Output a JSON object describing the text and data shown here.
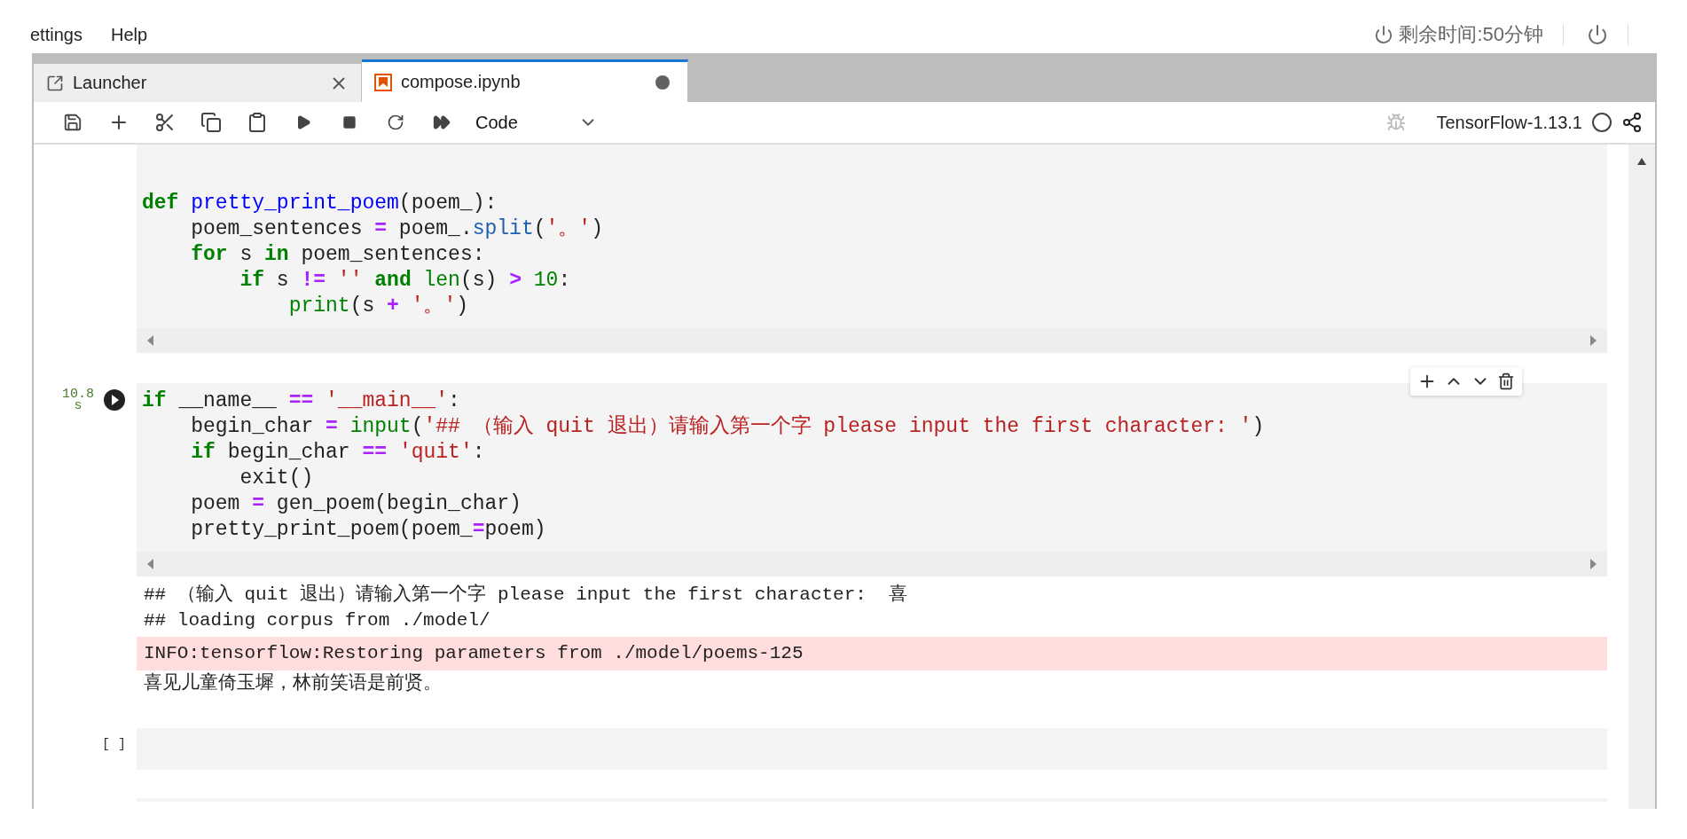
{
  "menu": [
    {
      "label": "ettings"
    },
    {
      "label": "Help"
    }
  ],
  "session": {
    "remaining": "剩余时间:50分钟"
  },
  "tabs": [
    {
      "label": "Launcher",
      "kind": "launcher",
      "selected": false,
      "dirty": false
    },
    {
      "label": "compose.ipynb",
      "kind": "notebook",
      "selected": true,
      "dirty": true
    }
  ],
  "toolbar": {
    "cell_type": "Code",
    "kernel": "TensorFlow-1.13.1"
  },
  "cells": [
    {
      "kind": "code",
      "run_button": false,
      "lines": [
        [
          {
            "kind": "kw",
            "text": "def "
          },
          {
            "kind": "fn",
            "text": "pretty_print_poem"
          },
          {
            "kind": "p",
            "text": "(poem_):"
          }
        ],
        [
          {
            "kind": "p",
            "text": "    poem_sentences "
          },
          {
            "kind": "op",
            "text": "="
          },
          {
            "kind": "p",
            "text": " poem_."
          },
          {
            "kind": "me",
            "text": "split"
          },
          {
            "kind": "p",
            "text": "("
          },
          {
            "kind": "st",
            "text": "'。'"
          },
          {
            "kind": "p",
            "text": ")"
          }
        ],
        [
          {
            "kind": "kw",
            "text": "    for"
          },
          {
            "kind": "p",
            "text": " s "
          },
          {
            "kind": "kw",
            "text": "in"
          },
          {
            "kind": "p",
            "text": " poem_sentences:"
          }
        ],
        [
          {
            "kind": "kw",
            "text": "        if"
          },
          {
            "kind": "p",
            "text": " s "
          },
          {
            "kind": "op",
            "text": "!="
          },
          {
            "kind": "st",
            "text": " ''"
          },
          {
            "kind": "kw",
            "text": " and"
          },
          {
            "kind": "bi",
            "text": " len"
          },
          {
            "kind": "p",
            "text": "(s) "
          },
          {
            "kind": "op",
            "text": ">"
          },
          {
            "kind": "nu",
            "text": " 10"
          },
          {
            "kind": "p",
            "text": ":"
          }
        ],
        [
          {
            "kind": "bi",
            "text": "            print"
          },
          {
            "kind": "p",
            "text": "(s "
          },
          {
            "kind": "op",
            "text": "+"
          },
          {
            "kind": "st",
            "text": " '。'"
          },
          {
            "kind": "p",
            "text": ")"
          }
        ]
      ]
    },
    {
      "kind": "code",
      "prompt": "10.8\ns",
      "run_button": true,
      "lines": [
        [
          {
            "kind": "kw",
            "text": "if"
          },
          {
            "kind": "p",
            "text": " __name__ "
          },
          {
            "kind": "op",
            "text": "=="
          },
          {
            "kind": "st",
            "text": " '__main__'"
          },
          {
            "kind": "p",
            "text": ":"
          }
        ],
        [
          {
            "kind": "p",
            "text": "    begin_char "
          },
          {
            "kind": "op",
            "text": "="
          },
          {
            "kind": "bi",
            "text": " input"
          },
          {
            "kind": "p",
            "text": "("
          },
          {
            "kind": "st",
            "text": "'## （输入 quit 退出）请输入第一个字 please input the first character: '"
          },
          {
            "kind": "p",
            "text": ")"
          }
        ],
        [
          {
            "kind": "kw",
            "text": "    if"
          },
          {
            "kind": "p",
            "text": " begin_char "
          },
          {
            "kind": "op",
            "text": "=="
          },
          {
            "kind": "st",
            "text": " 'quit'"
          },
          {
            "kind": "p",
            "text": ":"
          }
        ],
        [
          {
            "kind": "p",
            "text": "        exit()"
          }
        ],
        [
          {
            "kind": "p",
            "text": "    poem "
          },
          {
            "kind": "op",
            "text": "="
          },
          {
            "kind": "p",
            "text": " gen_poem(begin_char)"
          }
        ],
        [
          {
            "kind": "p",
            "text": "    pretty_print_poem(poem_"
          },
          {
            "kind": "op",
            "text": "="
          },
          {
            "kind": "p",
            "text": "poem)"
          }
        ]
      ],
      "outputs": [
        {
          "kind": "stdout",
          "text": "## （输入 quit 退出）请输入第一个字 please input the first character:  喜"
        },
        {
          "kind": "stdout",
          "text": "## loading corpus from ./model/"
        },
        {
          "kind": "stderr",
          "text": "INFO:tensorflow:Restoring parameters from ./model/poems-125"
        },
        {
          "kind": "stdout",
          "text": "喜见儿童倚玉墀，林前笑语是前贤。"
        }
      ]
    },
    {
      "kind": "empty",
      "prompt": "[ ]",
      "run_button": false
    }
  ]
}
